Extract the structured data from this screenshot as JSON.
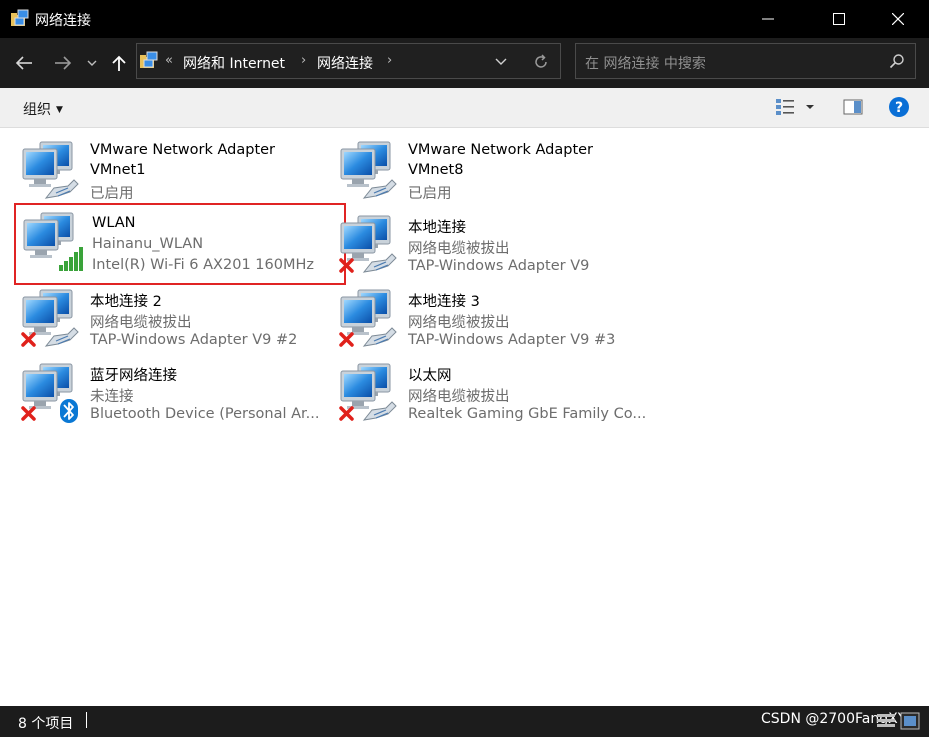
{
  "window": {
    "title": "网络连接"
  },
  "address": {
    "overflow": "«",
    "crumbs": [
      "网络和 Internet",
      "网络连接"
    ],
    "search_placeholder": "在 网络连接 中搜索"
  },
  "toolbar": {
    "organize_label": "组织"
  },
  "connections": [
    {
      "line1": "VMware Network Adapter",
      "line2": "VMnet1",
      "line3": "已启用",
      "badge": "cable-icon"
    },
    {
      "line1": "VMware Network Adapter",
      "line2": "VMnet8",
      "line3": "已启用",
      "badge": "cable-icon"
    },
    {
      "line1": "WLAN",
      "line2": "Hainanu_WLAN",
      "line3": "Intel(R) Wi-Fi 6 AX201 160MHz",
      "badge": "wifi-signal-icon"
    },
    {
      "line1": "本地连接",
      "line2": "网络电缆被拔出",
      "line3": "TAP-Windows Adapter V9",
      "badge": "disconnected-icon"
    },
    {
      "line1": "本地连接 2",
      "line2": "网络电缆被拔出",
      "line3": "TAP-Windows Adapter V9 #2",
      "badge": "disconnected-icon"
    },
    {
      "line1": "本地连接 3",
      "line2": "网络电缆被拔出",
      "line3": "TAP-Windows Adapter V9 #3",
      "badge": "disconnected-icon"
    },
    {
      "line1": "蓝牙网络连接",
      "line2": "未连接",
      "line3": "Bluetooth Device (Personal Ar...",
      "badge": "bluetooth-icon"
    },
    {
      "line1": "以太网",
      "line2": "网络电缆被拔出",
      "line3": "Realtek Gaming GbE Family Co...",
      "badge": "disconnected-icon"
    }
  ],
  "status": {
    "count": "8 个项目",
    "watermark": "CSDN @2700FangXY"
  },
  "colors": {
    "selection_border": "#e02424",
    "titlebar": "#000000",
    "help_blue": "#0a6fd6"
  }
}
